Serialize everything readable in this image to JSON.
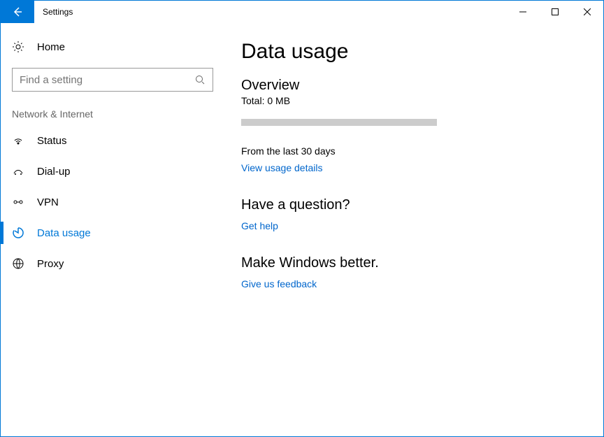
{
  "window": {
    "title": "Settings"
  },
  "sidebar": {
    "home": "Home",
    "search_placeholder": "Find a setting",
    "section": "Network & Internet",
    "items": [
      {
        "label": "Status"
      },
      {
        "label": "Dial-up"
      },
      {
        "label": "VPN"
      },
      {
        "label": "Data usage"
      },
      {
        "label": "Proxy"
      }
    ]
  },
  "main": {
    "title": "Data usage",
    "overview_heading": "Overview",
    "total": "Total: 0 MB",
    "period": "From the last 30 days",
    "details_link": "View usage details",
    "question_heading": "Have a question?",
    "help_link": "Get help",
    "feedback_heading": "Make Windows better.",
    "feedback_link": "Give us feedback"
  }
}
